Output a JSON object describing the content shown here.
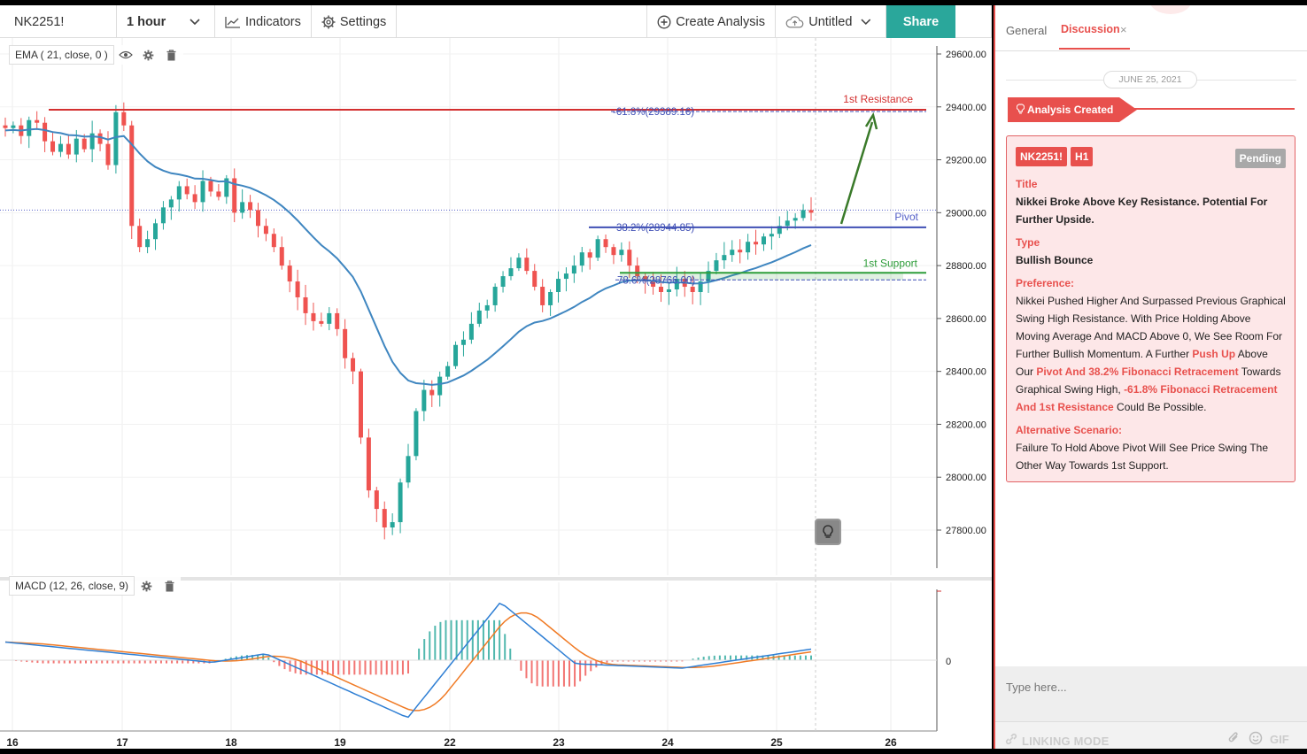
{
  "toolbar": {
    "symbol": "NK2251!",
    "interval": "1 hour",
    "indicators_label": "Indicators",
    "settings_label": "Settings",
    "create_analysis_label": "Create Analysis",
    "layout_name": "Untitled",
    "share_label": "Share"
  },
  "chart": {
    "ema_legend": "EMA ( 21, close, 0 )",
    "macd_legend": "MACD (12, 26, close, 9)",
    "price_ticks": [
      "29600.00",
      "29400.00",
      "29200.00",
      "29000.00",
      "28800.00",
      "28600.00",
      "28400.00",
      "28200.00",
      "28000.00",
      "27800.00"
    ],
    "macd_zero_label": "0",
    "date_ticks": [
      "16",
      "17",
      "18",
      "19",
      "22",
      "23",
      "24",
      "25",
      "26"
    ],
    "annotations": {
      "resistance_label": "1st Resistance",
      "pivot_label": "Pivot",
      "support_label": "1st Support",
      "fib_618_label": "-61.8%(29389.16)",
      "fib_382_label": "38.2%(28944.85)",
      "fib_786_label": "78.6%(28766.00)"
    },
    "colors": {
      "up": "#26a69a",
      "down": "#ef5350",
      "ema": "#3f86c0",
      "resistance": "#d32f2f",
      "pivot": "#3f4fb5",
      "support": "#2e9d3a",
      "arrow": "#3a7a2a",
      "macd": "#2f7fd4",
      "signal": "#f07a24"
    }
  },
  "chart_data": {
    "type": "candlestick",
    "symbol": "NK2251!",
    "interval": "1 hour",
    "ylim": [
      27700,
      29600
    ],
    "x_ticks": [
      "16",
      "17",
      "18",
      "19",
      "22",
      "23",
      "24",
      "25",
      "26"
    ],
    "levels": {
      "first_resistance": 29389.16,
      "pivot": 28944.85,
      "first_support": 28766.0,
      "fib_minus_61_8": 29389.16,
      "fib_38_2": 28944.85,
      "fib_78_6": 28766.0
    },
    "close_path": [
      29320,
      29330,
      29290,
      29350,
      29340,
      29270,
      29230,
      29260,
      29220,
      29280,
      29240,
      29300,
      29260,
      29180,
      29380,
      29330,
      28950,
      28870,
      28900,
      28960,
      29020,
      29050,
      29100,
      29070,
      29040,
      29120,
      29080,
      29060,
      29130,
      29000,
      29040,
      29010,
      28950,
      28920,
      28870,
      28800,
      28740,
      28680,
      28620,
      28590,
      28580,
      28620,
      28560,
      28450,
      28400,
      28150,
      27950,
      27880,
      27810,
      27830,
      27980,
      28080,
      28250,
      28330,
      28310,
      28380,
      28420,
      28500,
      28520,
      28580,
      28630,
      28650,
      28720,
      28760,
      28790,
      28830,
      28780,
      28720,
      28650,
      28700,
      28750,
      28770,
      28800,
      28850,
      28830,
      28900,
      28870,
      28840,
      28860,
      28800,
      28760,
      28740,
      28720,
      28700,
      28710,
      28750,
      28720,
      28700,
      28740,
      28780,
      28820,
      28840,
      28860,
      28850,
      28890,
      28880,
      28910,
      28920,
      28950,
      28970,
      28980,
      29010,
      29000
    ],
    "ema_start": 29310,
    "indicators": [
      "EMA (21, close, 0)",
      "MACD (12, 26, close, 9)"
    ]
  },
  "panel": {
    "tab_general": "General",
    "tab_discussion": "Discussion",
    "tab_close": "×",
    "date": "JUNE 25, 2021",
    "analysis_created": "Analysis Created",
    "card": {
      "symbol_chip": "NK2251!",
      "interval_chip": "H1",
      "status": "Pending",
      "title_label": "Title",
      "title_value": "Nikkei Broke Above Key Resistance. Potential For Further Upside.",
      "type_label": "Type",
      "type_value": "Bullish Bounce",
      "preference_label": "Preference:",
      "pref_1": "Nikkei Pushed Higher And Surpassed Previous Graphical Swing High Resistance. With Price Holding Above Moving Average And MACD Above 0, We See Room For Further Bullish Momentum. A Further ",
      "pref_hl_1": "Push Up",
      "pref_2": " Above Our ",
      "pref_hl_2": "Pivot And 38.2% Fibonacci Retracement",
      "pref_3": " Towards Graphical Swing High, ",
      "pref_hl_3": "-61.8% Fibonacci Retracement And 1st Resistance",
      "pref_4": " Could Be Possible.",
      "alt_label": "Alternative Scenario:",
      "alt_value": "Failure To Hold Above Pivot Will See Price Swing The Other Way Towards 1st Support."
    },
    "input_placeholder": "Type here...",
    "linking_mode": "LINKING MODE",
    "gif_label": "GIF"
  }
}
